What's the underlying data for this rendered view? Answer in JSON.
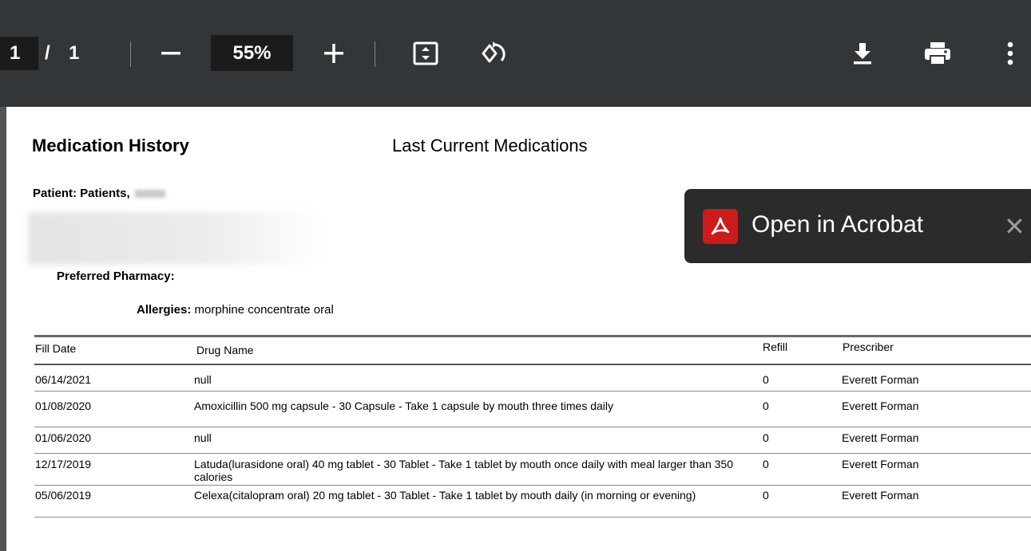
{
  "toolbar": {
    "page_current": "1",
    "page_sep": "/",
    "page_total": "1",
    "zoom": "55%",
    "icons": [
      "minus-icon",
      "plus-icon",
      "fit-page-icon",
      "rotate-icon",
      "download-icon",
      "print-icon",
      "more-vert-icon"
    ]
  },
  "doc": {
    "title": "Medication History",
    "subtitle": "Last Current Medications",
    "patient_label": "Patient:  Patients,",
    "pharmacy_label": "Preferred Pharmacy:",
    "allergies_label": "Allergies:",
    "allergies_value": " morphine concentrate oral",
    "headers": {
      "fill_date": "Fill Date",
      "drug_name": "Drug Name",
      "refill": "Refill",
      "prescriber": "Prescriber"
    },
    "rows": [
      {
        "date": "06/14/2021",
        "drug": "null",
        "refill": "0",
        "prescriber": "Everett Forman"
      },
      {
        "date": "01/08/2020",
        "drug": "Amoxicillin 500 mg capsule -  30 Capsule - Take 1 capsule by mouth three times daily",
        "refill": "0",
        "prescriber": "Everett Forman"
      },
      {
        "date": "01/06/2020",
        "drug": "null",
        "refill": "0",
        "prescriber": "Everett Forman"
      },
      {
        "date": "12/17/2019",
        "drug": "Latuda(lurasidone oral) 40 mg tablet -  30 Tablet - Take 1 tablet by mouth once daily with meal larger than 350 calories",
        "refill": "0",
        "prescriber": "Everett Forman"
      },
      {
        "date": "05/06/2019",
        "drug": "Celexa(citalopram oral) 20 mg tablet - 30 Tablet - Take 1 tablet by mouth daily (in morning or evening)",
        "refill": "0",
        "prescriber": "Everett Forman"
      }
    ]
  },
  "toast": {
    "label": "Open in Acrobat",
    "close": "✕"
  },
  "colors": {
    "toolbar": "#323639",
    "acrobat_red": "#cc1b1b"
  }
}
